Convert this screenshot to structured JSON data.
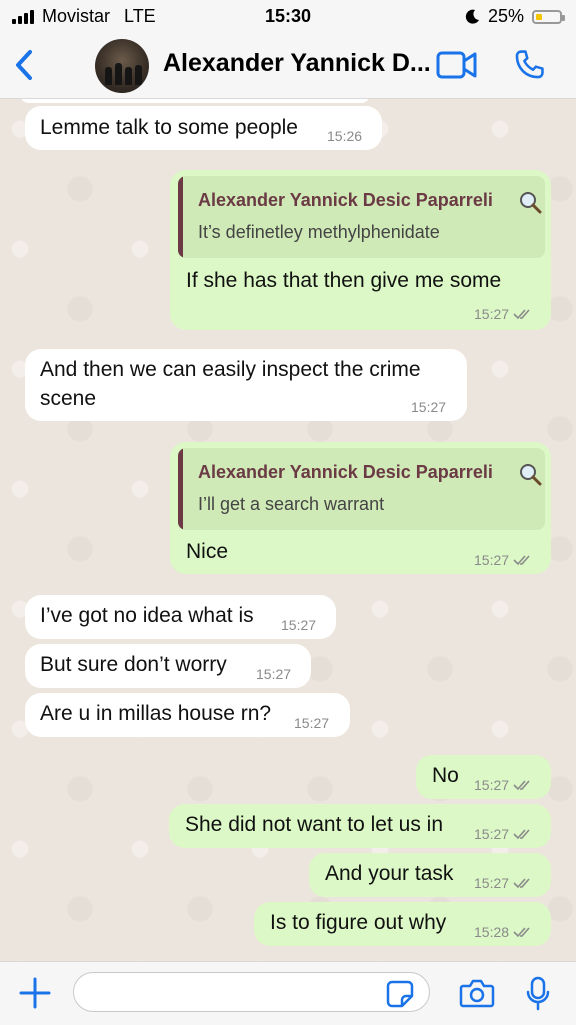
{
  "status_bar": {
    "carrier": "Movistar",
    "network": "LTE",
    "time": "15:30",
    "battery": "25%",
    "battery_level": 0.25,
    "battery_color": "#f5c500"
  },
  "header": {
    "contact_name": "Alexander Yannick D...",
    "back_icon": "chevron-left-icon",
    "video_icon": "video-camera-icon",
    "call_icon": "phone-icon",
    "accent_color": "#1a73e8"
  },
  "messages": [
    {
      "dir": "in",
      "text": "Lemme talk to some people",
      "time": "15:26"
    },
    {
      "dir": "out",
      "quote_author": "Alexander Yannick Desic Paparreli",
      "quote_text": "It’s definetley methylphenidate",
      "text": "If she has that then give me some",
      "time": "15:27",
      "read": true
    },
    {
      "dir": "in",
      "text_line1": "And then we can easily inspect the crime",
      "text_line2": "scene",
      "time": "15:27"
    },
    {
      "dir": "out",
      "quote_author": "Alexander Yannick Desic Paparreli",
      "quote_text": "I’ll get a search warrant",
      "text": "Nice",
      "time": "15:27",
      "read": true
    },
    {
      "dir": "in",
      "text": "I’ve got no idea what is",
      "time": "15:27"
    },
    {
      "dir": "in",
      "text": "But sure don’t worry",
      "time": "15:27"
    },
    {
      "dir": "in",
      "text": "Are u in millas house rn?",
      "time": "15:27"
    },
    {
      "dir": "out",
      "text": "No",
      "time": "15:27",
      "read": true
    },
    {
      "dir": "out",
      "text": "She did not want to let us in",
      "time": "15:27",
      "read": true
    },
    {
      "dir": "out",
      "text": "And your task",
      "time": "15:27",
      "read": true
    },
    {
      "dir": "out",
      "text": "Is to figure out why",
      "time": "15:28",
      "read": true
    }
  ],
  "composer": {
    "placeholder": "",
    "icons": [
      "plus-icon",
      "sticker-icon",
      "camera-icon",
      "microphone-icon"
    ]
  },
  "colors": {
    "outgoing_bubble": "#dcf8c6",
    "incoming_bubble": "#ffffff",
    "quote_author": "#6b3a44",
    "chat_background": "#ece5dd"
  }
}
